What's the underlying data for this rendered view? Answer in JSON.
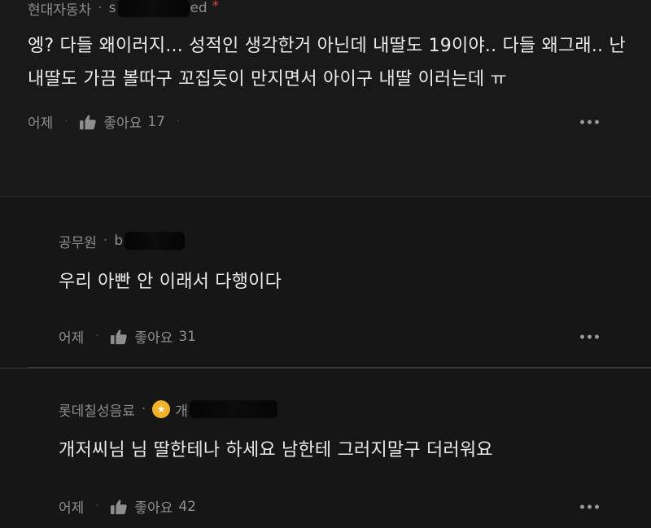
{
  "comments": [
    {
      "author": "현대자동차",
      "handle_prefix": "s",
      "handle_suffix": "ed",
      "author_marker": "*",
      "text": "엥? 다들 왜이러지... 성적인 생각한거 아닌데 내딸도 19이야.. 다들 왜그래.. 난 내딸도 가끔 볼따구 꼬집듯이 만지면서 아이구 내딸 이러는데 ㅠ",
      "time": "어제",
      "like_label": "좋아요",
      "like_count": "17"
    }
  ],
  "replies": [
    {
      "author": "공무원",
      "handle_prefix": "b",
      "text": "우리 아빤 안 이래서 다행이다",
      "time": "어제",
      "like_label": "좋아요",
      "like_count": "31"
    },
    {
      "author": "롯데칠성음료",
      "handle_prefix": "개",
      "badge_color": "#f1b12a",
      "text": "개저씨님 님 딸한테나 하세요 남한테 그러지말구 더러워요",
      "time": "어제",
      "like_label": "좋아요",
      "like_count": "42"
    }
  ],
  "icons": {
    "like": "thumbs-up-icon",
    "more": "more-options-icon",
    "badge": "gold-badge-icon"
  }
}
